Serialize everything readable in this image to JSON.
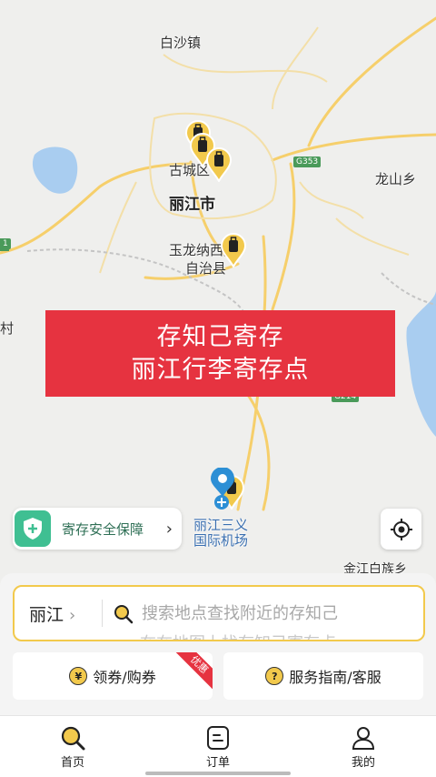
{
  "map": {
    "labels": {
      "baisha": "白沙镇",
      "gucheng": "古城区",
      "lijiang_city": "丽江市",
      "yulong": "玉龙纳西族",
      "yulong2": "自治县",
      "longshan": "龙山乡",
      "village_left": "村",
      "airport1": "丽江三义",
      "airport2": "国际机场",
      "jinjiang": "金江白族乡",
      "road_g353": "G353",
      "road_left": "1",
      "road_g214": "G214"
    }
  },
  "banner": {
    "line1": "存知己寄存",
    "line2": "丽江行李寄存点"
  },
  "safety": {
    "label": "寄存安全保障"
  },
  "search": {
    "city": "丽江",
    "placeholder": "搜索地点查找附近的存知己",
    "ghost": "在在地图上找存知己寄存点"
  },
  "actions": {
    "coupon_label": "领券/购券",
    "coupon_badge": "优惠",
    "service_label": "服务指南/客服"
  },
  "tabs": [
    {
      "label": "首页"
    },
    {
      "label": "订单"
    },
    {
      "label": "我的"
    }
  ],
  "colors": {
    "accent": "#f2c94c",
    "banner": "#e63340",
    "safety": "#3fbf92"
  }
}
